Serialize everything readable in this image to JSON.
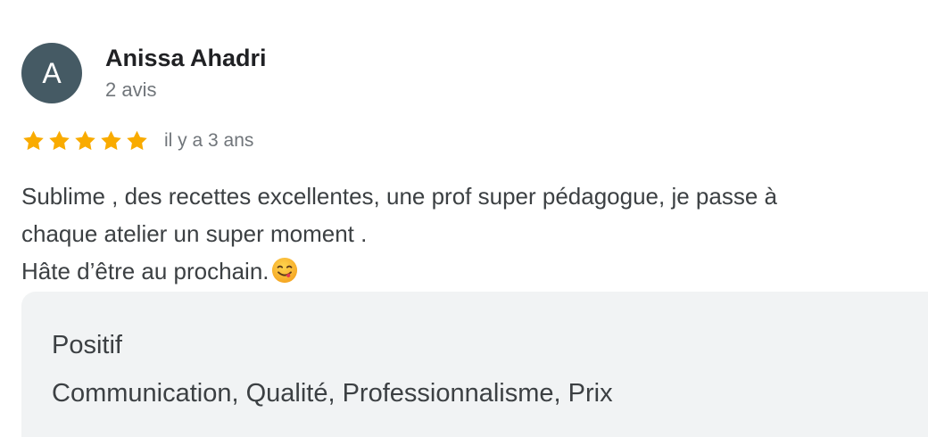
{
  "author": {
    "initial": "A",
    "name": "Anissa Ahadri",
    "review_count": "2 avis"
  },
  "rating": {
    "stars": 5,
    "max_stars": 5,
    "star_color": "#f9ab00",
    "date": "il y a 3 ans"
  },
  "review": {
    "lines": [
      "Sublime , des recettes excellentes, une prof super pédagogue, je passe à",
      "chaque atelier un super moment .",
      "Hâte d’être au prochain."
    ],
    "emoji": "face-savoring-food-emoji"
  },
  "highlights": {
    "title": "Positif",
    "values": "Communication, Qualité, Professionnalisme, Prix"
  },
  "colors": {
    "avatar_bg": "#455a64",
    "panel_bg": "#f1f3f4"
  }
}
